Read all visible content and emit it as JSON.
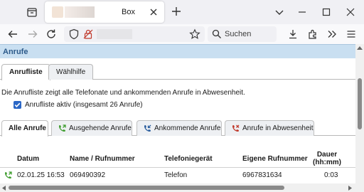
{
  "browser": {
    "tab_title": "Box",
    "search_placeholder": "Suchen"
  },
  "page": {
    "section_title": "Anrufe",
    "function_tabs": [
      "Anrufliste",
      "Wählhilfe"
    ],
    "description": "Die Anrufliste zeigt alle Telefonate und ankommenden Anrufe in Abwesenheit.",
    "checkbox": {
      "label": "Anrufliste aktiv (insgesamt 26 Anrufe)",
      "checked": true
    },
    "call_tabs": [
      {
        "label": "Alle Anrufe",
        "icon": "none"
      },
      {
        "label": "Ausgehende Anrufe",
        "icon": "outgoing-call-icon"
      },
      {
        "label": "Ankommende Anrufe",
        "icon": "incoming-call-icon"
      },
      {
        "label": "Anrufe in Abwesenheit",
        "icon": "missed-call-icon"
      }
    ],
    "table": {
      "headers": {
        "datum": "Datum",
        "name": "Name / Rufnummer",
        "geraet": "Telefoniegerät",
        "eigene": "Eigene Rufnummer",
        "dauer_line1": "Dauer",
        "dauer_line2": "(hh:mm)"
      },
      "rows": [
        {
          "datum": "02.01.25 16:53",
          "name": "069490392",
          "geraet": "Telefon",
          "eigene": "6967831634",
          "dauer": "0:03",
          "type_icon": "outgoing-call-icon"
        }
      ]
    }
  },
  "colors": {
    "section_header_bg": "#c9dff1",
    "section_title": "#2c5a8a",
    "checkbox_accent": "#2b67c6",
    "outgoing_green": "#3f9d2f",
    "incoming_blue": "#2b5e9e",
    "missed_red": "#c0392b"
  }
}
